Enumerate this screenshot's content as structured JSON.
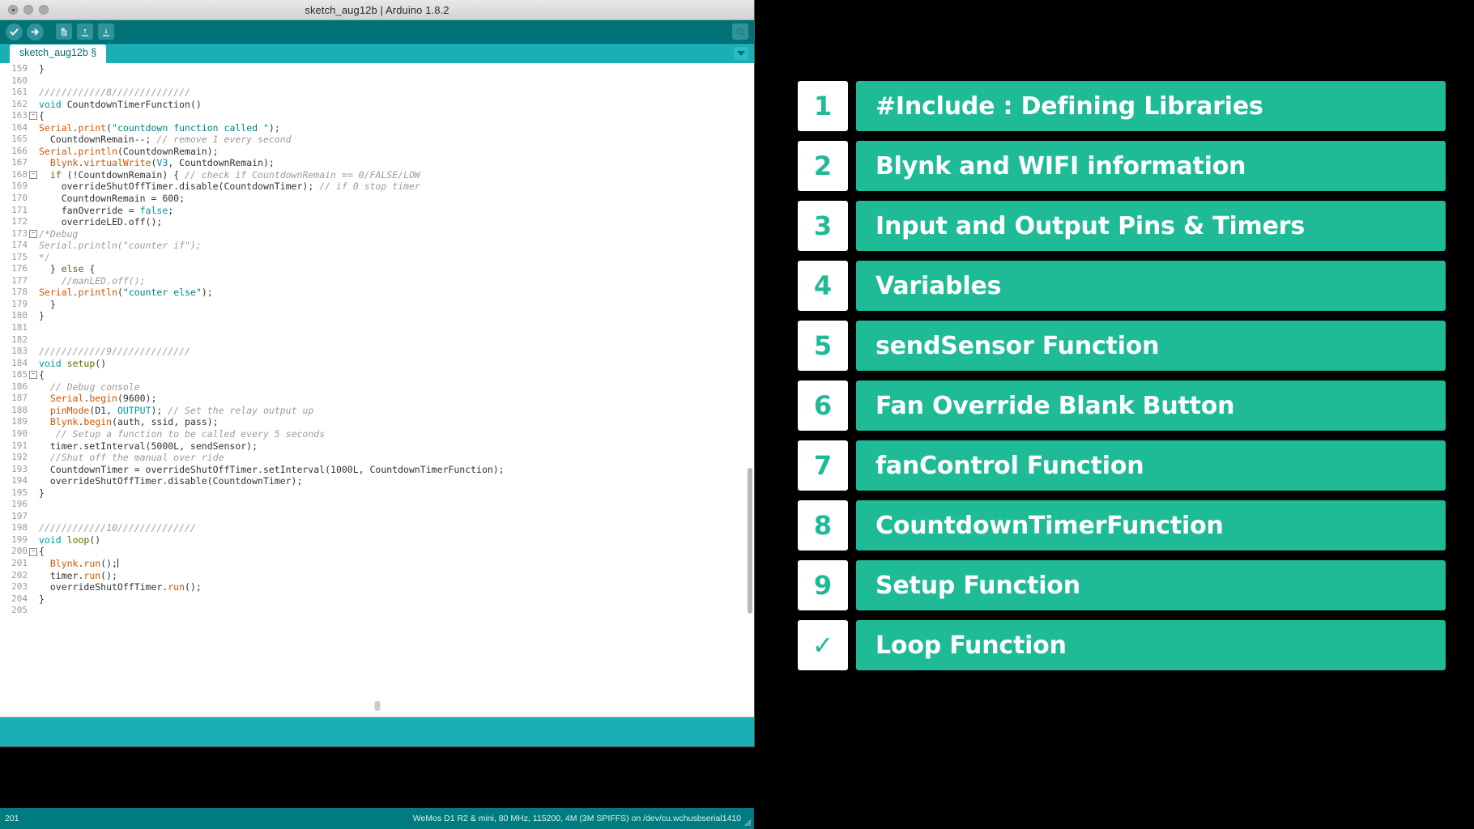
{
  "window": {
    "title": "sketch_aug12b | Arduino 1.8.2",
    "traffic_lights": [
      "close",
      "minimize",
      "zoom"
    ]
  },
  "toolbar": {
    "verify_label": "Verify",
    "upload_label": "Upload",
    "new_label": "New",
    "open_label": "Open",
    "save_label": "Save",
    "serial_monitor_label": "Serial Monitor",
    "icons": [
      "check-icon",
      "arrow-right-icon",
      "new-file-icon",
      "upload-arrow-icon",
      "download-arrow-icon",
      "magnifier-icon"
    ],
    "bg_color": "#027279"
  },
  "tabbar": {
    "tab_label": "sketch_aug12b §",
    "menu_icon": "chevron-down-icon",
    "bg_color": "#1aafb5"
  },
  "editor": {
    "first_line": 159,
    "lines": [
      {
        "n": 159,
        "fold": "",
        "segs": [
          {
            "t": "}",
            "c": "num"
          }
        ]
      },
      {
        "n": 160,
        "fold": "",
        "segs": []
      },
      {
        "n": 161,
        "fold": "",
        "segs": [
          {
            "t": "////////////8//////////////",
            "c": "cm"
          }
        ]
      },
      {
        "n": 162,
        "fold": "",
        "segs": [
          {
            "t": "void",
            "c": "kw"
          },
          {
            "t": " CountdownTimerFunction()",
            "c": "num"
          }
        ]
      },
      {
        "n": 163,
        "fold": "minus",
        "segs": [
          {
            "t": "{",
            "c": "num"
          }
        ]
      },
      {
        "n": 164,
        "fold": "",
        "segs": [
          {
            "t": "Serial",
            "c": "fn"
          },
          {
            "t": ".",
            "c": "num"
          },
          {
            "t": "print",
            "c": "fn"
          },
          {
            "t": "(",
            "c": "num"
          },
          {
            "t": "\"countdown function called \"",
            "c": "str"
          },
          {
            "t": ");",
            "c": "num"
          }
        ]
      },
      {
        "n": 165,
        "fold": "",
        "segs": [
          {
            "t": "  CountdownRemain--; ",
            "c": "num"
          },
          {
            "t": "// remove 1 every second",
            "c": "cm"
          }
        ]
      },
      {
        "n": 166,
        "fold": "",
        "segs": [
          {
            "t": "Serial",
            "c": "fn"
          },
          {
            "t": ".",
            "c": "num"
          },
          {
            "t": "println",
            "c": "fn"
          },
          {
            "t": "(CountdownRemain);",
            "c": "num"
          }
        ]
      },
      {
        "n": 167,
        "fold": "",
        "segs": [
          {
            "t": "  ",
            "c": "num"
          },
          {
            "t": "Blynk",
            "c": "fn"
          },
          {
            "t": ".",
            "c": "num"
          },
          {
            "t": "virtualWrite",
            "c": "fn"
          },
          {
            "t": "(",
            "c": "num"
          },
          {
            "t": "V3",
            "c": "lit"
          },
          {
            "t": ", CountdownRemain);",
            "c": "num"
          }
        ]
      },
      {
        "n": 168,
        "fold": "minus",
        "segs": [
          {
            "t": "  ",
            "c": "num"
          },
          {
            "t": "if",
            "c": "fn2"
          },
          {
            "t": " (!CountdownRemain) { ",
            "c": "num"
          },
          {
            "t": "// check if CountdownRemain == 0/FALSE/LOW",
            "c": "cm"
          }
        ]
      },
      {
        "n": 169,
        "fold": "",
        "segs": [
          {
            "t": "    overrideShutOffTimer.disable(CountdownTimer); ",
            "c": "num"
          },
          {
            "t": "// if 0 stop timer",
            "c": "cm"
          }
        ]
      },
      {
        "n": 170,
        "fold": "",
        "segs": [
          {
            "t": "    CountdownRemain = 600;",
            "c": "num"
          }
        ]
      },
      {
        "n": 171,
        "fold": "",
        "segs": [
          {
            "t": "    fanOverride = ",
            "c": "num"
          },
          {
            "t": "false",
            "c": "lit"
          },
          {
            "t": ";",
            "c": "num"
          }
        ]
      },
      {
        "n": 172,
        "fold": "",
        "segs": [
          {
            "t": "    overrideLED.off();",
            "c": "num"
          }
        ]
      },
      {
        "n": 173,
        "fold": "minus",
        "segs": [
          {
            "t": "/*Debug",
            "c": "cm"
          }
        ]
      },
      {
        "n": 174,
        "fold": "",
        "segs": [
          {
            "t": "Serial.println(\"counter if\");",
            "c": "cm"
          }
        ]
      },
      {
        "n": 175,
        "fold": "",
        "segs": [
          {
            "t": "*/",
            "c": "cm"
          }
        ]
      },
      {
        "n": 176,
        "fold": "",
        "segs": [
          {
            "t": "  } ",
            "c": "num"
          },
          {
            "t": "else",
            "c": "fn2"
          },
          {
            "t": " {",
            "c": "num"
          }
        ]
      },
      {
        "n": 177,
        "fold": "",
        "segs": [
          {
            "t": "    ",
            "c": "num"
          },
          {
            "t": "//manLED.off();",
            "c": "cm"
          }
        ]
      },
      {
        "n": 178,
        "fold": "",
        "segs": [
          {
            "t": "Serial",
            "c": "fn"
          },
          {
            "t": ".",
            "c": "num"
          },
          {
            "t": "println",
            "c": "fn"
          },
          {
            "t": "(",
            "c": "num"
          },
          {
            "t": "\"counter else\"",
            "c": "str"
          },
          {
            "t": ");",
            "c": "num"
          }
        ]
      },
      {
        "n": 179,
        "fold": "",
        "segs": [
          {
            "t": "  }",
            "c": "num"
          }
        ]
      },
      {
        "n": 180,
        "fold": "",
        "segs": [
          {
            "t": "}",
            "c": "num"
          }
        ]
      },
      {
        "n": 181,
        "fold": "",
        "segs": []
      },
      {
        "n": 182,
        "fold": "",
        "segs": []
      },
      {
        "n": 183,
        "fold": "",
        "segs": [
          {
            "t": "////////////9//////////////",
            "c": "cm"
          }
        ]
      },
      {
        "n": 184,
        "fold": "",
        "segs": [
          {
            "t": "void",
            "c": "kw"
          },
          {
            "t": " ",
            "c": "num"
          },
          {
            "t": "setup",
            "c": "fn2"
          },
          {
            "t": "()",
            "c": "num"
          }
        ]
      },
      {
        "n": 185,
        "fold": "minus",
        "segs": [
          {
            "t": "{",
            "c": "num"
          }
        ]
      },
      {
        "n": 186,
        "fold": "",
        "segs": [
          {
            "t": "  ",
            "c": "num"
          },
          {
            "t": "// Debug console",
            "c": "cm"
          }
        ]
      },
      {
        "n": 187,
        "fold": "",
        "segs": [
          {
            "t": "  ",
            "c": "num"
          },
          {
            "t": "Serial",
            "c": "fn"
          },
          {
            "t": ".",
            "c": "num"
          },
          {
            "t": "begin",
            "c": "fn"
          },
          {
            "t": "(9600);",
            "c": "num"
          }
        ]
      },
      {
        "n": 188,
        "fold": "",
        "segs": [
          {
            "t": "  ",
            "c": "num"
          },
          {
            "t": "pinMode",
            "c": "fn"
          },
          {
            "t": "(D1, ",
            "c": "num"
          },
          {
            "t": "OUTPUT",
            "c": "lit"
          },
          {
            "t": "); ",
            "c": "num"
          },
          {
            "t": "// Set the relay output up",
            "c": "cm"
          }
        ]
      },
      {
        "n": 189,
        "fold": "",
        "segs": [
          {
            "t": "  ",
            "c": "num"
          },
          {
            "t": "Blynk",
            "c": "fn"
          },
          {
            "t": ".",
            "c": "num"
          },
          {
            "t": "begin",
            "c": "fn"
          },
          {
            "t": "(auth, ssid, pass);",
            "c": "num"
          }
        ]
      },
      {
        "n": 190,
        "fold": "",
        "segs": [
          {
            "t": "   ",
            "c": "num"
          },
          {
            "t": "// Setup a function to be called every 5 seconds",
            "c": "cm"
          }
        ]
      },
      {
        "n": 191,
        "fold": "",
        "segs": [
          {
            "t": "  timer.setInterval(5000L, sendSensor);",
            "c": "num"
          }
        ]
      },
      {
        "n": 192,
        "fold": "",
        "segs": [
          {
            "t": "  ",
            "c": "num"
          },
          {
            "t": "//Shut off the manual over ride",
            "c": "cm"
          }
        ]
      },
      {
        "n": 193,
        "fold": "",
        "segs": [
          {
            "t": "  CountdownTimer = overrideShutOffTimer.setInterval(1000L, CountdownTimerFunction);",
            "c": "num"
          }
        ]
      },
      {
        "n": 194,
        "fold": "",
        "segs": [
          {
            "t": "  overrideShutOffTimer.disable(CountdownTimer);",
            "c": "num"
          }
        ]
      },
      {
        "n": 195,
        "fold": "",
        "segs": [
          {
            "t": "}",
            "c": "num"
          }
        ]
      },
      {
        "n": 196,
        "fold": "",
        "segs": []
      },
      {
        "n": 197,
        "fold": "",
        "segs": []
      },
      {
        "n": 198,
        "fold": "",
        "segs": [
          {
            "t": "////////////10//////////////",
            "c": "cm"
          }
        ]
      },
      {
        "n": 199,
        "fold": "",
        "segs": [
          {
            "t": "void",
            "c": "kw"
          },
          {
            "t": " ",
            "c": "num"
          },
          {
            "t": "loop",
            "c": "fn2"
          },
          {
            "t": "()",
            "c": "num"
          }
        ]
      },
      {
        "n": 200,
        "fold": "minus",
        "segs": [
          {
            "t": "{",
            "c": "num"
          }
        ]
      },
      {
        "n": 201,
        "fold": "",
        "segs": [
          {
            "t": "  ",
            "c": "num"
          },
          {
            "t": "Blynk",
            "c": "fn"
          },
          {
            "t": ".",
            "c": "num"
          },
          {
            "t": "run",
            "c": "fn"
          },
          {
            "t": "();",
            "c": "num"
          }
        ],
        "caret": true
      },
      {
        "n": 202,
        "fold": "",
        "segs": [
          {
            "t": "  timer.",
            "c": "num"
          },
          {
            "t": "run",
            "c": "fn"
          },
          {
            "t": "();",
            "c": "num"
          }
        ]
      },
      {
        "n": 203,
        "fold": "",
        "segs": [
          {
            "t": "  overrideShutOffTimer.",
            "c": "num"
          },
          {
            "t": "run",
            "c": "fn"
          },
          {
            "t": "();",
            "c": "num"
          }
        ]
      },
      {
        "n": 204,
        "fold": "",
        "segs": [
          {
            "t": "}",
            "c": "num"
          }
        ]
      },
      {
        "n": 205,
        "fold": "",
        "segs": []
      }
    ]
  },
  "statusbar": {
    "line_number": "201",
    "board_info": "WeMos D1 R2 & mini, 80 MHz, 115200, 4M (3M SPIFFS) on /dev/cu.wchusbserial1410",
    "bg_color": "#007b80"
  },
  "agenda": {
    "accent_color": "#1fba96",
    "items": [
      {
        "num": "1",
        "label": "#Include : Defining Libraries"
      },
      {
        "num": "2",
        "label": "Blynk and WIFI information"
      },
      {
        "num": "3",
        "label": "Input and Output Pins & Timers"
      },
      {
        "num": "4",
        "label": "Variables"
      },
      {
        "num": "5",
        "label": "sendSensor Function"
      },
      {
        "num": "6",
        "label": "Fan Override Blank Button"
      },
      {
        "num": "7",
        "label": "fanControl Function"
      },
      {
        "num": "8",
        "label": "CountdownTimerFunction"
      },
      {
        "num": "9",
        "label": "Setup Function"
      },
      {
        "num": "✓",
        "label": "Loop Function"
      }
    ]
  }
}
